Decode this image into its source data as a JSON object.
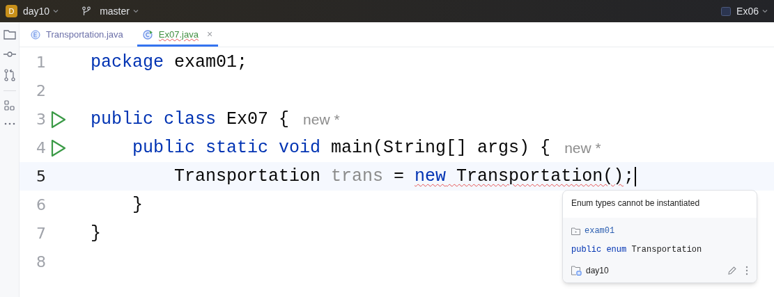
{
  "top_bar": {
    "project_badge": "D",
    "project": "day10",
    "branch": "master",
    "run_config": "Ex06"
  },
  "tabs": [
    {
      "label": "Transportation.java",
      "kind": "enum",
      "selected": false,
      "error": false
    },
    {
      "label": "Ex07.java",
      "kind": "class",
      "selected": true,
      "error": true,
      "close": "×"
    }
  ],
  "editor": {
    "lines": [
      {
        "number": "1",
        "current": false,
        "runnable": false,
        "tokens": [
          {
            "kind": "keyword",
            "text": "package"
          },
          {
            "kind": "text",
            "text": " exam01;"
          }
        ]
      },
      {
        "number": "2",
        "current": false,
        "runnable": false
      },
      {
        "number": "3",
        "current": false,
        "runnable": true,
        "tokens": [
          {
            "kind": "keyword",
            "text": "public class"
          },
          {
            "kind": "text",
            "text": " Ex07 {"
          },
          {
            "kind": "hint",
            "text": "new *"
          }
        ]
      },
      {
        "number": "4",
        "current": false,
        "runnable": true,
        "tokens": [
          {
            "kind": "keyword",
            "text": "    public static void"
          },
          {
            "kind": "text",
            "text": " main(String[] args) {"
          },
          {
            "kind": "hint",
            "text": "new *"
          }
        ]
      },
      {
        "number": "5",
        "current": true,
        "runnable": false,
        "tokens": [
          {
            "kind": "text",
            "text": "        Transportation "
          },
          {
            "kind": "unused",
            "text": "trans"
          },
          {
            "kind": "text",
            "text": " = "
          },
          {
            "kind": "keyword",
            "text": "new",
            "error": true
          },
          {
            "kind": "text",
            "text": " Transportation()",
            "error": true
          },
          {
            "kind": "text",
            "text": ";"
          }
        ]
      },
      {
        "number": "6",
        "current": false,
        "runnable": false,
        "tokens": [
          {
            "kind": "text",
            "text": "    }"
          }
        ]
      },
      {
        "number": "7",
        "current": false,
        "runnable": false,
        "tokens": [
          {
            "kind": "text",
            "text": "}"
          }
        ]
      },
      {
        "number": "8",
        "current": false,
        "runnable": false
      }
    ]
  },
  "popup": {
    "message": "Enum types cannot be instantiated",
    "package": "exam01",
    "declaration_keywords": "public enum",
    "declaration_name": "Transportation",
    "module": "day10"
  }
}
